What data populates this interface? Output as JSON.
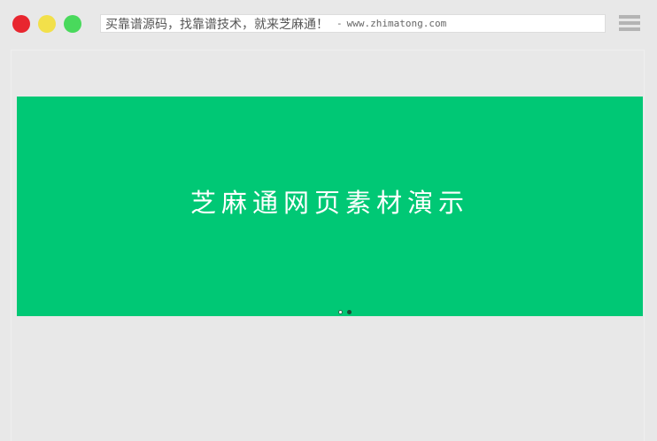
{
  "window": {
    "controls": [
      {
        "name": "close",
        "color": "#e8262f"
      },
      {
        "name": "minimize",
        "color": "#f2e04a"
      },
      {
        "name": "maximize",
        "color": "#49d95c"
      }
    ],
    "address": {
      "title": "买靠谱源码，找靠谱技术，就来芝麻通！",
      "separator": "-",
      "url": "www.zhimatong.com"
    },
    "menu_icon": "hamburger-menu-icon",
    "menu_color": "#b4b4b4"
  },
  "slider": {
    "background": "#00c875",
    "title": "芝麻通网页素材演示",
    "dots": [
      {
        "label": "slide 1",
        "active": true
      },
      {
        "label": "slide 2",
        "active": false
      }
    ]
  }
}
